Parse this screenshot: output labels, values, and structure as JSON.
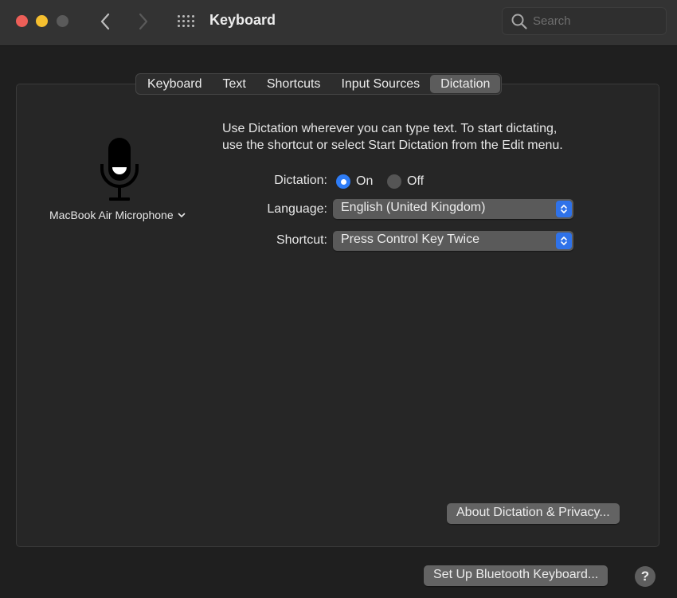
{
  "window": {
    "title": "Keyboard",
    "search_placeholder": "Search",
    "traffic_lights": {
      "close": "#ed5f58",
      "minimize": "#f5bf2f",
      "maximize": "#5a5a5a"
    }
  },
  "tabs": [
    {
      "label": "Keyboard",
      "active": false
    },
    {
      "label": "Text",
      "active": false
    },
    {
      "label": "Shortcuts",
      "active": false
    },
    {
      "label": "Input Sources",
      "active": false
    },
    {
      "label": "Dictation",
      "active": true
    }
  ],
  "microphone": {
    "icon": "microphone-icon",
    "source_label": "MacBook Air Microphone"
  },
  "dictation": {
    "description_line1": "Use Dictation wherever you can type text. To start dictating,",
    "description_line2": "use the shortcut or select Start Dictation from the Edit menu.",
    "dictation_label": "Dictation:",
    "on_label": "On",
    "off_label": "Off",
    "selected": "On",
    "language_label": "Language:",
    "language_value": "English (United Kingdom)",
    "shortcut_label": "Shortcut:",
    "shortcut_value": "Press Control Key Twice"
  },
  "buttons": {
    "about": "About Dictation & Privacy...",
    "bluetooth": "Set Up Bluetooth Keyboard...",
    "help": "?"
  },
  "colors": {
    "accent": "#2e7cf6",
    "background": "#1f1f1f",
    "titlebar": "#333333"
  }
}
